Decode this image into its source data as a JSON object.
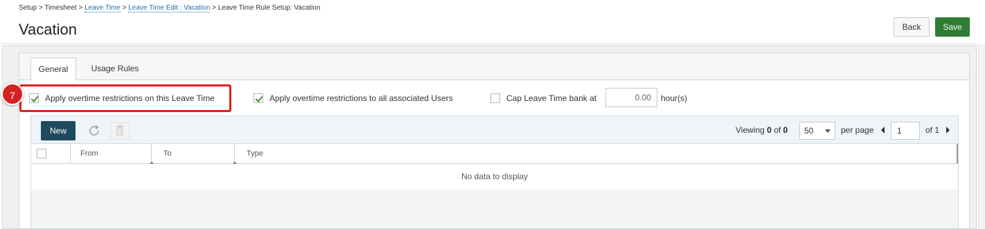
{
  "breadcrumb": {
    "items": [
      {
        "label": "Setup",
        "link": false
      },
      {
        "label": "Timesheet",
        "link": false
      },
      {
        "label": "Leave Time",
        "link": true
      },
      {
        "label": "Leave Time Edit : Vacation",
        "link": true
      },
      {
        "label": "Leave Time Rule Setup: Vacation",
        "link": false
      }
    ],
    "separator": ">"
  },
  "header": {
    "title": "Vacation",
    "back_label": "Back",
    "save_label": "Save"
  },
  "tabs": [
    {
      "label": "General",
      "active": true
    },
    {
      "label": "Usage Rules",
      "active": false
    }
  ],
  "options": {
    "restrict_leave_time": {
      "label": "Apply overtime restrictions on this Leave Time",
      "checked": true
    },
    "restrict_users": {
      "label": "Apply overtime restrictions to all associated Users",
      "checked": true
    },
    "cap_bank": {
      "label": "Cap Leave Time bank at",
      "checked": false,
      "value": "0.00",
      "unit": "hour(s)"
    }
  },
  "annotation": {
    "step": "7"
  },
  "grid": {
    "new_label": "New",
    "viewing_label": "Viewing",
    "viewing_from": "0",
    "of_label": "of",
    "viewing_total": "0",
    "page_size": "50",
    "per_page_label": "per page",
    "current_page": "1",
    "of_pages_label": "of 1",
    "columns": [
      "From",
      "To",
      "Type"
    ],
    "empty_message": "No data to display"
  },
  "colors": {
    "save_button": "#2e7d32",
    "new_button": "#1e4a5e",
    "link": "#1f6bb5",
    "highlight": "#e02020",
    "checkmark": "#4a8a2a"
  }
}
